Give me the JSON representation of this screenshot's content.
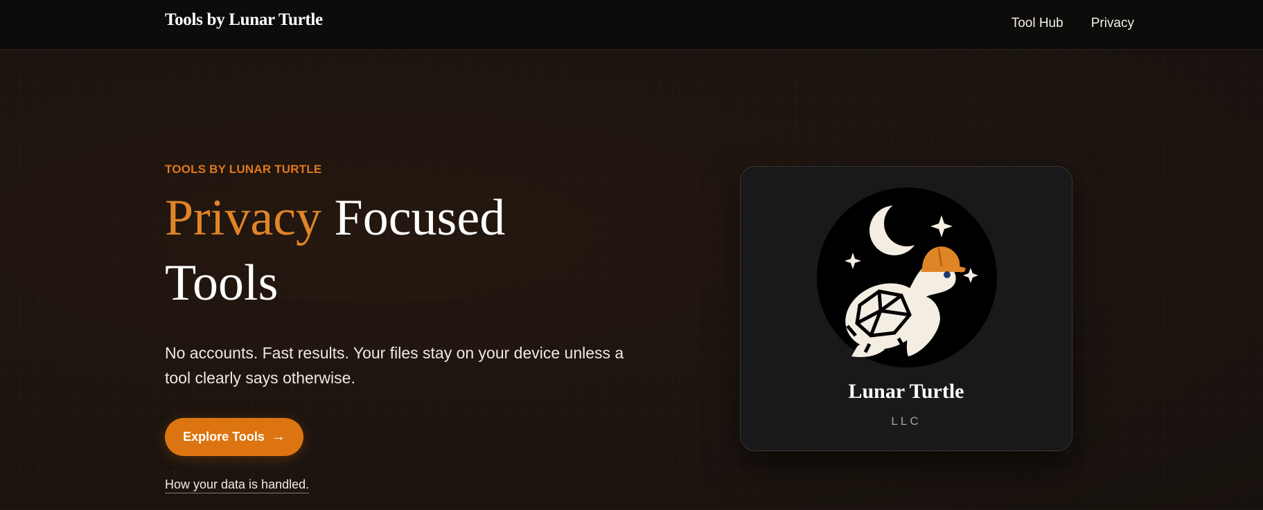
{
  "header": {
    "brand": "Tools by Lunar Turtle",
    "nav": [
      {
        "label": "Tool Hub"
      },
      {
        "label": "Privacy"
      }
    ]
  },
  "hero": {
    "eyebrow": "TOOLS BY LUNAR TURTLE",
    "title_accent": "Privacy",
    "title_rest": " Focused Tools",
    "lede": "No accounts. Fast results. Your files stay on your device unless a tool clearly says otherwise.",
    "cta_label": "Explore Tools",
    "cta_icon": "arrow-right-icon",
    "data_link": "How your data is handled."
  },
  "card": {
    "logo_icon": "turtle-moon-logo-icon",
    "name": "Lunar Turtle",
    "sub": "LLC"
  },
  "colors": {
    "accent": "#dc7511",
    "accent_text": "#e08527",
    "header_bg": "#0d0c0b",
    "page_bg": "#1b130f",
    "card_bg": "#19191b"
  }
}
